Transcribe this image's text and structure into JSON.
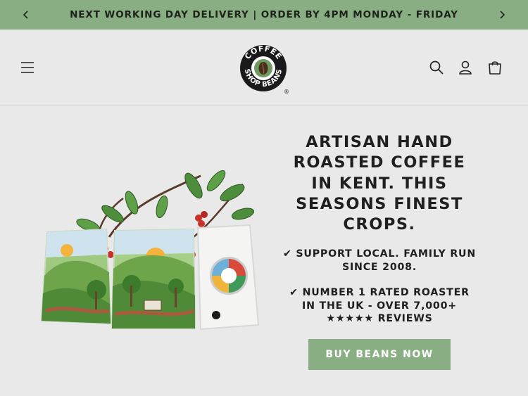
{
  "announcement": {
    "text": "NEXT WORKING DAY DELIVERY | ORDER BY 4PM MONDAY - FRIDAY",
    "prev_icon": "chevron-left-icon",
    "next_icon": "chevron-right-icon"
  },
  "header": {
    "menu_icon": "hamburger-icon",
    "logo": {
      "text": "COFFEE BEANS SHOP",
      "registered": "®"
    },
    "icons": [
      "search-icon",
      "account-icon",
      "cart-icon"
    ]
  },
  "hero": {
    "headline": "ARTISAN HAND ROASTED COFFEE IN KENT. THIS SEASONS FINEST CROPS.",
    "bullets": [
      "✔ SUPPORT LOCAL. FAMILY RUN SINCE 2008.",
      "✔ NUMBER 1 RATED ROASTER IN THE UK - OVER 7,000+",
      "★★★★★ REVIEWS"
    ],
    "cta_label": "BUY BEANS NOW"
  },
  "colors": {
    "accent": "#8aae84",
    "background": "#e9e9e9",
    "text": "#1f1f1f"
  }
}
